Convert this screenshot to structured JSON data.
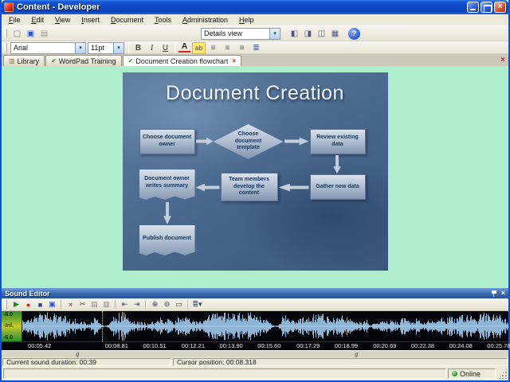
{
  "window": {
    "title": "Content - Developer"
  },
  "glyphs": {
    "close": "×",
    "chevron_down": "▾",
    "help": "?"
  },
  "menu": {
    "items": [
      "File",
      "Edit",
      "View",
      "Insert",
      "Document",
      "Tools",
      "Administration",
      "Help"
    ]
  },
  "toolbar1": {
    "icons": [
      {
        "name": "new-document-icon",
        "glyph": "▢",
        "color": "#6a7a8a"
      },
      {
        "name": "save-icon",
        "glyph": "▣",
        "color": "#2a4ed8"
      },
      {
        "name": "print-icon",
        "glyph": "▤",
        "color": "#9a968a"
      }
    ],
    "details_view_value": "Details view",
    "view_buttons": [
      {
        "name": "layout-single-icon",
        "glyph": "◧",
        "color": "#4a5a88"
      },
      {
        "name": "layout-split-icon",
        "glyph": "◨",
        "color": "#4a5a88"
      },
      {
        "name": "layout-columns-icon",
        "glyph": "◫",
        "color": "#4a5a88"
      },
      {
        "name": "layout-grid-icon",
        "glyph": "▦",
        "color": "#4a5a88"
      }
    ]
  },
  "toolbar2": {
    "font_value": "Arial",
    "size_value": "11pt",
    "format_buttons": [
      {
        "name": "bold-button",
        "glyph": "B",
        "cls": "fb-bold"
      },
      {
        "name": "italic-button",
        "glyph": "I",
        "cls": "fb-italic"
      },
      {
        "name": "underline-button",
        "glyph": "U",
        "cls": "fb-underline"
      }
    ],
    "icons": [
      {
        "name": "text-color-icon",
        "glyph": "A",
        "cls": "ic-acolor"
      },
      {
        "name": "highlight-icon",
        "glyph": "ab",
        "cls": "ic-highlight"
      },
      {
        "name": "align-left-icon",
        "glyph": "≡",
        "cls": "ic-alignl"
      },
      {
        "name": "align-center-icon",
        "glyph": "≡",
        "cls": "ic-alignc"
      },
      {
        "name": "align-right-icon",
        "glyph": "≡",
        "cls": "ic-alignr"
      },
      {
        "name": "bullets-icon",
        "glyph": "≣",
        "color": "#4a5a88"
      }
    ]
  },
  "tabs": [
    {
      "icon": "▥",
      "icon_color": "#8a7a4a",
      "label": "Library"
    },
    {
      "icon": "✔",
      "icon_color": "#189a18",
      "label": "WordPad Training"
    },
    {
      "icon": "✔",
      "icon_color": "#189a18",
      "label": "Document Creation flowchart",
      "active": true,
      "closable": true,
      "close_glyph": "×"
    }
  ],
  "slide": {
    "title": "Document Creation",
    "nodes": {
      "choose_owner": "Choose document owner",
      "choose_template": "Choose document template",
      "review_existing": "Review existing data",
      "owner_summary": "Document owner writes summary",
      "team_develop": "Team members develop the content",
      "gather_new": "Gather new data",
      "publish": "Publish document"
    }
  },
  "sound_editor": {
    "title": "Sound Editor",
    "toolbar_icons": [
      {
        "name": "play-icon",
        "glyph": "▶",
        "color": "#1a8a1a"
      },
      {
        "name": "record-icon",
        "glyph": "●",
        "color": "#cc2222"
      },
      {
        "name": "stop-icon",
        "glyph": "■",
        "color": "#24408a"
      },
      {
        "name": "save-icon",
        "glyph": "▣",
        "color": "#2a4ed8"
      },
      {
        "name": "sep"
      },
      {
        "name": "delete-icon",
        "glyph": "×",
        "color": "#bb2222"
      },
      {
        "name": "cut-icon",
        "glyph": "✂",
        "color": "#555555"
      },
      {
        "name": "copy-icon",
        "glyph": "▤",
        "color": "#888888"
      },
      {
        "name": "paste-icon",
        "glyph": "▥",
        "color": "#888888"
      },
      {
        "name": "sep"
      },
      {
        "name": "goto-start-icon",
        "glyph": "⇤",
        "color": "#334455"
      },
      {
        "name": "goto-end-icon",
        "glyph": "⇥",
        "color": "#334455"
      },
      {
        "name": "sep"
      },
      {
        "name": "zoom-in-icon",
        "glyph": "⊕",
        "color": "#334455"
      },
      {
        "name": "zoom-out-icon",
        "glyph": "⊖",
        "color": "#334455"
      },
      {
        "name": "zoom-fit-icon",
        "glyph": "▭",
        "color": "#334455"
      },
      {
        "name": "sep"
      },
      {
        "name": "options-menu-icon",
        "glyph": "≣▾",
        "color": "#334455"
      }
    ],
    "scale": {
      "top": "-6.0",
      "mid": "-Inf.",
      "bottom": "-6.0"
    },
    "waveform_color": "#9cc8ec",
    "cursor_x": 16.4,
    "time_labels": [
      {
        "t": "00:05.42",
        "x": 7.5
      },
      {
        "t": "00:08.81",
        "x": 22.7
      },
      {
        "t": "00:10.51",
        "x": 30.2
      },
      {
        "t": "00:12.21",
        "x": 37.8
      },
      {
        "t": "00:13.90",
        "x": 45.3
      },
      {
        "t": "00:15.60",
        "x": 52.8
      },
      {
        "t": "00:17.29",
        "x": 60.5
      },
      {
        "t": "00:18.99",
        "x": 68.0
      },
      {
        "t": "00:20.69",
        "x": 75.6
      },
      {
        "t": "00:22.38",
        "x": 83.1
      },
      {
        "t": "00:24.08",
        "x": 90.6
      },
      {
        "t": "00:25.78",
        "x": 98.1
      }
    ],
    "markers": [
      {
        "label": "g",
        "x": 15
      },
      {
        "label": "g",
        "x": 70
      }
    ],
    "status_duration": "Current sound duration: 00:39",
    "status_cursor": "Cursor position: 00:08.318"
  },
  "statusbar": {
    "online": "Online"
  }
}
